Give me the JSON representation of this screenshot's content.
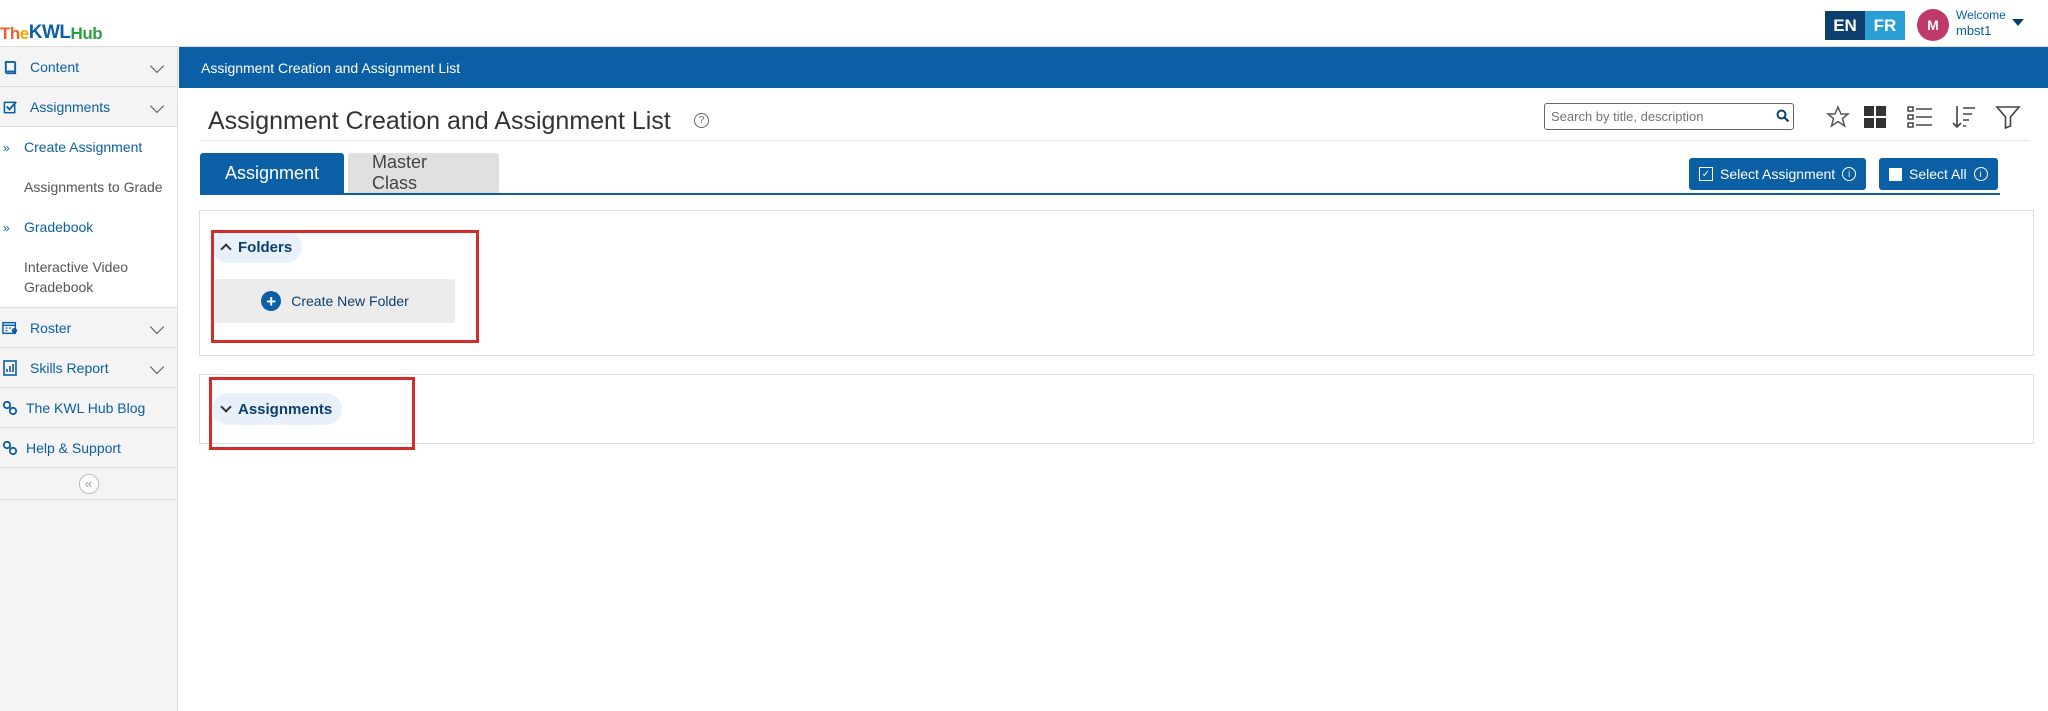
{
  "app": {
    "logo_text": "TheKWLHub",
    "logo_letters": [
      {
        "ch": "T",
        "color": "#e8632b"
      },
      {
        "ch": "h",
        "color": "#e8632b"
      },
      {
        "ch": "e",
        "color": "#f0a500"
      },
      {
        "ch": "K",
        "color": "#0b5fa5"
      },
      {
        "ch": "W",
        "color": "#0b5fa5"
      },
      {
        "ch": "L",
        "color": "#0b5fa5"
      },
      {
        "ch": "H",
        "color": "#2e9e44"
      },
      {
        "ch": "u",
        "color": "#2e9e44"
      },
      {
        "ch": "b",
        "color": "#2e9e44"
      }
    ]
  },
  "header": {
    "lang_en": "EN",
    "lang_fr": "FR",
    "avatar_initial": "M",
    "welcome": "Welcome",
    "username": "mbst1"
  },
  "sidebar": {
    "content": "Content",
    "assignments": "Assignments",
    "sub_items": {
      "create": "Create Assignment",
      "to_grade": "Assignments to Grade",
      "gradebook": "Gradebook",
      "video_gradebook": "Interactive Video Gradebook"
    },
    "roster": "Roster",
    "skills_report": "Skills Report",
    "blog": "The KWL Hub Blog",
    "help": "Help & Support",
    "collapse_glyph": "«"
  },
  "main": {
    "bar_title": "Assignment Creation and Assignment List",
    "page_title": "Assignment Creation and Assignment List",
    "search_placeholder": "Search by title, description",
    "tabs": [
      "Assignment",
      "Master Class"
    ],
    "select_assignment": "Select Assignment",
    "select_all": "Select All",
    "folders_label": "Folders",
    "create_folder": "Create New Folder",
    "assignments_label": "Assignments"
  },
  "colors": {
    "brand_blue": "#0b5fa5",
    "highlight_red": "#d42b2b"
  }
}
